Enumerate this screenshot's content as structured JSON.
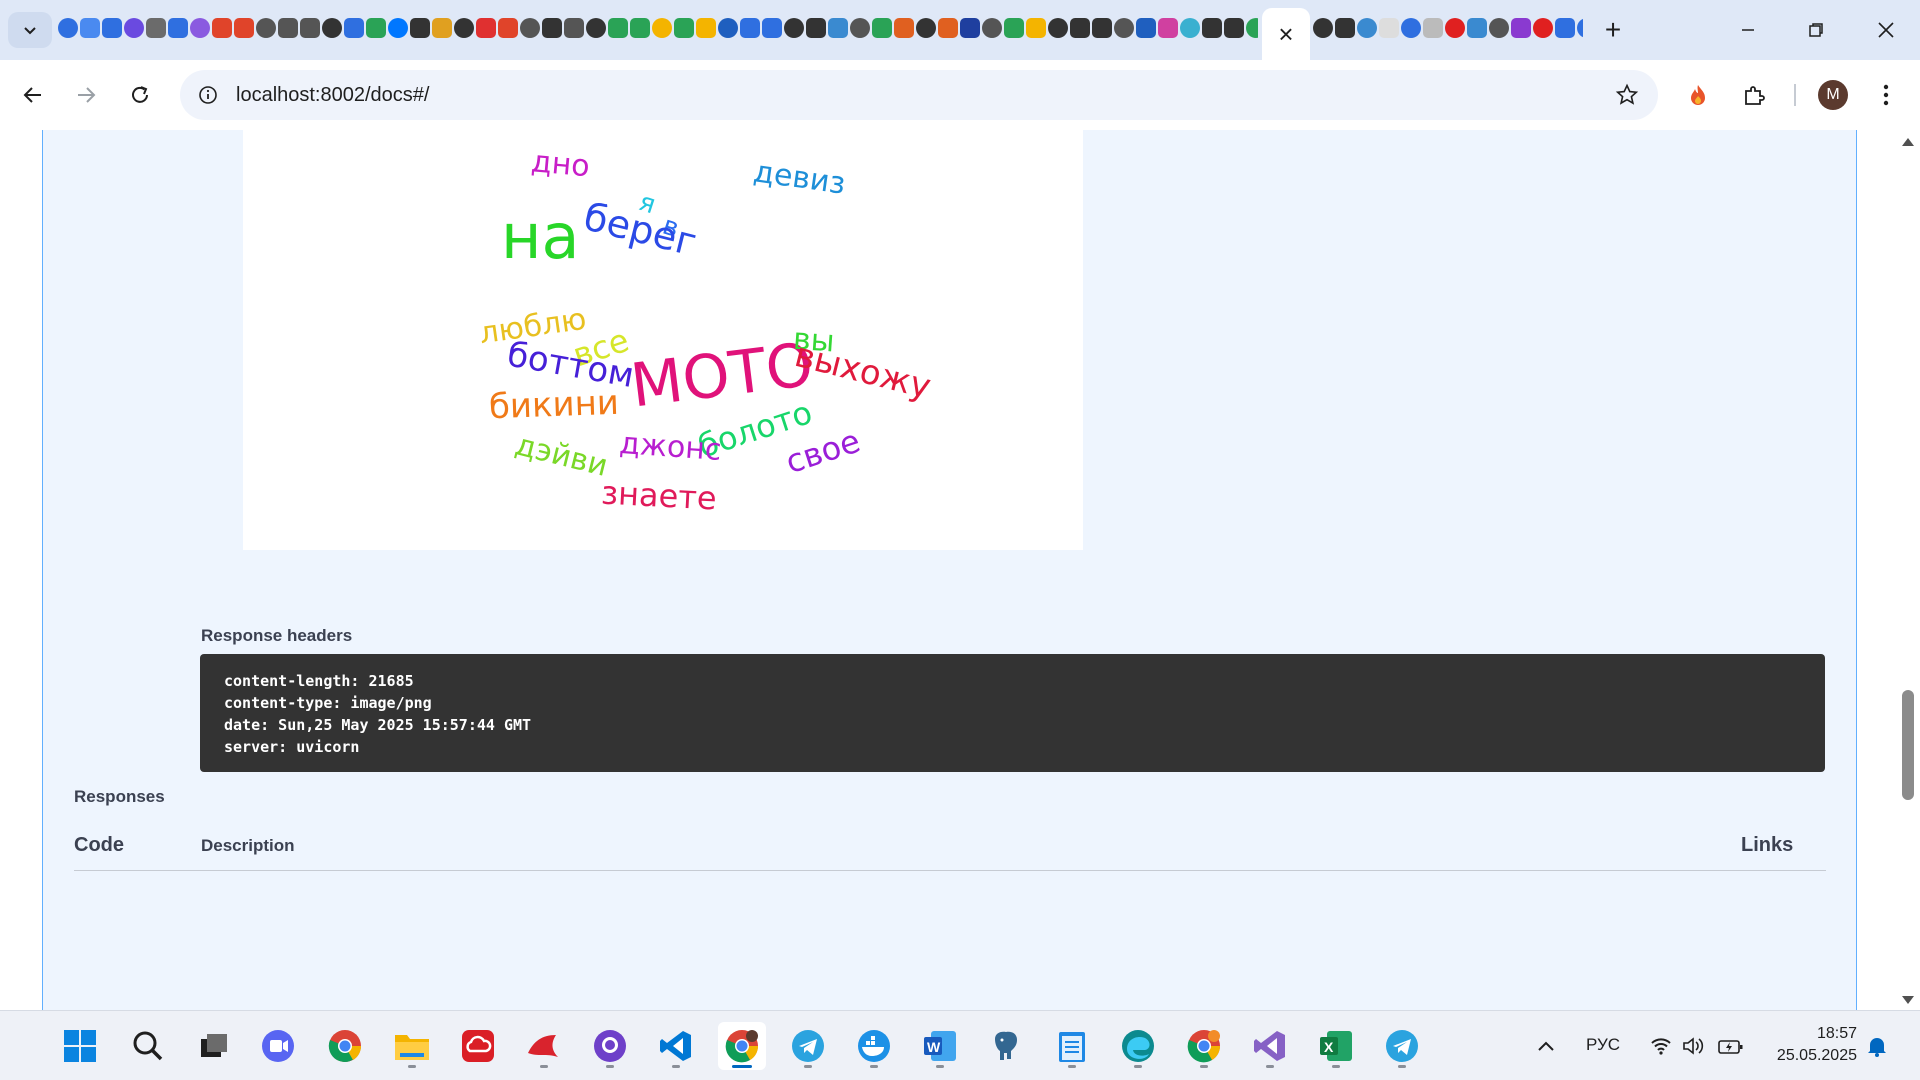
{
  "browser": {
    "url": "localhost:8002/docs#/",
    "active_tab_close": "×",
    "new_tab": "+",
    "profile_initial": "M"
  },
  "word_cloud": {
    "words": [
      {
        "text": "дно",
        "color": "#c81ec8"
      },
      {
        "text": "девиз",
        "color": "#1e8fd8"
      },
      {
        "text": "я",
        "color": "#22c6e0"
      },
      {
        "text": "в",
        "color": "#2a6cf0"
      },
      {
        "text": "на",
        "color": "#28d628"
      },
      {
        "text": "берег",
        "color": "#2b4ae6"
      },
      {
        "text": "люблю",
        "color": "#e8c020"
      },
      {
        "text": "все",
        "color": "#d6e62a"
      },
      {
        "text": "боттом",
        "color": "#4620d8"
      },
      {
        "text": "МОТО",
        "color": "#e0127a"
      },
      {
        "text": "вы",
        "color": "#34d834"
      },
      {
        "text": "выхожу",
        "color": "#e01a3c"
      },
      {
        "text": "бикини",
        "color": "#f07a18"
      },
      {
        "text": "болото",
        "color": "#18d66a"
      },
      {
        "text": "свое",
        "color": "#9a1ed8"
      },
      {
        "text": "джонс",
        "color": "#b81ed0"
      },
      {
        "text": "дэйви",
        "color": "#7ad828"
      },
      {
        "text": "знаете",
        "color": "#e01a5a"
      }
    ]
  },
  "response": {
    "headers_label": "Response headers",
    "headers": [
      "content-length: 21685",
      "content-type: image/png",
      "date: Sun,25 May 2025 15:57:44 GMT",
      "server: uvicorn"
    ]
  },
  "responses": {
    "title": "Responses",
    "col_code": "Code",
    "col_description": "Description",
    "col_links": "Links"
  },
  "taskbar": {
    "language": "РУС",
    "time": "18:57",
    "date": "25.05.2025"
  }
}
